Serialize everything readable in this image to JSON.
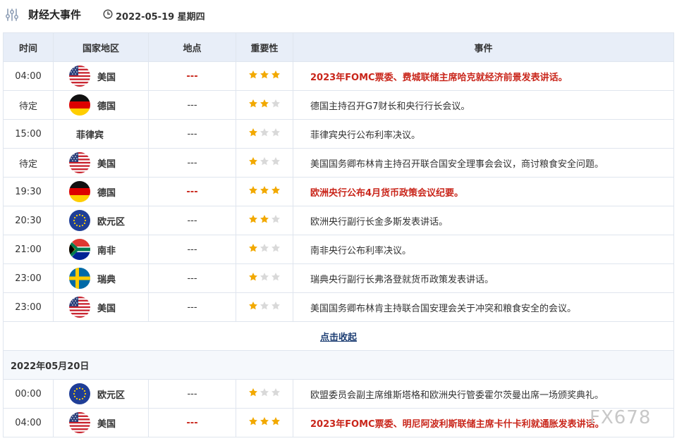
{
  "header": {
    "title": "财经大事件",
    "date": "2022-05-19 星期四"
  },
  "columns": {
    "time": "时间",
    "country": "国家地区",
    "location": "地点",
    "importance": "重要性",
    "event": "事件"
  },
  "events_today": [
    {
      "time": "04:00",
      "country": "美国",
      "flag": "us",
      "location": "---",
      "stars": 3,
      "highlight": true,
      "event": "2023年FOMC票委、费城联储主席哈克就经济前景发表讲话。"
    },
    {
      "time": "待定",
      "country": "德国",
      "flag": "de",
      "location": "---",
      "stars": 2,
      "highlight": false,
      "event": "德国主持召开G7财长和央行行长会议。"
    },
    {
      "time": "15:00",
      "country": "菲律宾",
      "flag": "",
      "location": "---",
      "stars": 1,
      "highlight": false,
      "event": "菲律宾央行公布利率决议。"
    },
    {
      "time": "待定",
      "country": "美国",
      "flag": "us",
      "location": "---",
      "stars": 1,
      "highlight": false,
      "event": "美国国务卿布林肯主持召开联合国安全理事会会议，商讨粮食安全问题。"
    },
    {
      "time": "19:30",
      "country": "德国",
      "flag": "de",
      "location": "---",
      "stars": 3,
      "highlight": true,
      "event": "欧洲央行公布4月货币政策会议纪要。"
    },
    {
      "time": "20:30",
      "country": "欧元区",
      "flag": "eu",
      "location": "---",
      "stars": 2,
      "highlight": false,
      "event": "欧洲央行副行长金多斯发表讲话。"
    },
    {
      "time": "21:00",
      "country": "南非",
      "flag": "za",
      "location": "---",
      "stars": 1,
      "highlight": false,
      "event": "南非央行公布利率决议。"
    },
    {
      "time": "23:00",
      "country": "瑞典",
      "flag": "se",
      "location": "---",
      "stars": 1,
      "highlight": false,
      "event": "瑞典央行副行长弗洛登就货币政策发表讲话。"
    },
    {
      "time": "23:00",
      "country": "美国",
      "flag": "us",
      "location": "---",
      "stars": 1,
      "highlight": false,
      "event": "美国国务卿布林肯主持联合国安理会关于冲突和粮食安全的会议。"
    }
  ],
  "collapse_label": "点击收起",
  "next_day_label": "2022年05月20日",
  "events_next": [
    {
      "time": "00:00",
      "country": "欧元区",
      "flag": "eu",
      "location": "---",
      "stars": 1,
      "highlight": false,
      "event": "欧盟委员会副主席维斯塔格和欧洲央行管委霍尔茨曼出席一场颁奖典礼。"
    },
    {
      "time": "04:00",
      "country": "美国",
      "flag": "us",
      "location": "---",
      "stars": 3,
      "highlight": true,
      "event": "2023年FOMC票委、明尼阿波利斯联储主席卡什卡利就通胀发表讲话。"
    }
  ],
  "watermark": "FX678",
  "colors": {
    "highlight_red": "#c9261b",
    "star_gold": "#f2a900",
    "star_gray": "#d9d9d9",
    "header_bg": "#e8eef8",
    "link_blue": "#1e3f74"
  }
}
